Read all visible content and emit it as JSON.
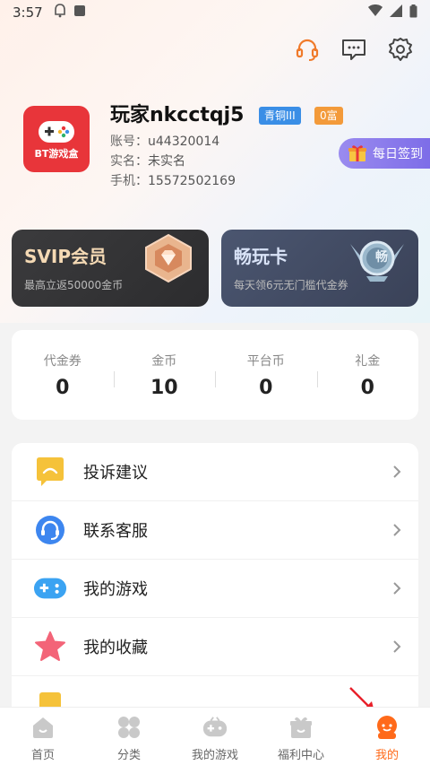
{
  "status_bar": {
    "time": "3:57"
  },
  "header": {
    "icons": [
      "headset-icon",
      "chat-icon",
      "gear-icon"
    ]
  },
  "profile": {
    "avatar_text": "BT游戏盒",
    "username": "玩家nkcctqj5",
    "level_badge": "青铜III",
    "rich_badge": "0富",
    "account_label": "账号：",
    "account_value": "u44320014",
    "realname_label": "实名：",
    "realname_value": "未实名",
    "phone_label": "手机：",
    "phone_value": "15572502169",
    "checkin_label": "每日签到"
  },
  "cards": {
    "svip": {
      "title": "SVIP会员",
      "subtitle": "最高立返50000金币"
    },
    "play": {
      "title": "畅玩卡",
      "subtitle": "每天领6元无门槛代金券",
      "badge_text": "畅"
    }
  },
  "stats": [
    {
      "label": "代金券",
      "value": "0"
    },
    {
      "label": "金币",
      "value": "10"
    },
    {
      "label": "平台币",
      "value": "0"
    },
    {
      "label": "礼金",
      "value": "0"
    }
  ],
  "menu": [
    {
      "label": "投诉建议",
      "icon": "feedback-icon"
    },
    {
      "label": "联系客服",
      "icon": "customer-service-icon"
    },
    {
      "label": "我的游戏",
      "icon": "gamepad-icon"
    },
    {
      "label": "我的收藏",
      "icon": "star-icon"
    }
  ],
  "tabbar": [
    {
      "label": "首页",
      "icon": "home-icon"
    },
    {
      "label": "分类",
      "icon": "category-icon"
    },
    {
      "label": "我的游戏",
      "icon": "my-games-icon"
    },
    {
      "label": "福利中心",
      "icon": "gift-icon"
    },
    {
      "label": "我的",
      "icon": "profile-icon",
      "active": true
    }
  ],
  "colors": {
    "accent": "#ff6a1a",
    "level": "#3a8ee6",
    "rich": "#f39a3a"
  }
}
